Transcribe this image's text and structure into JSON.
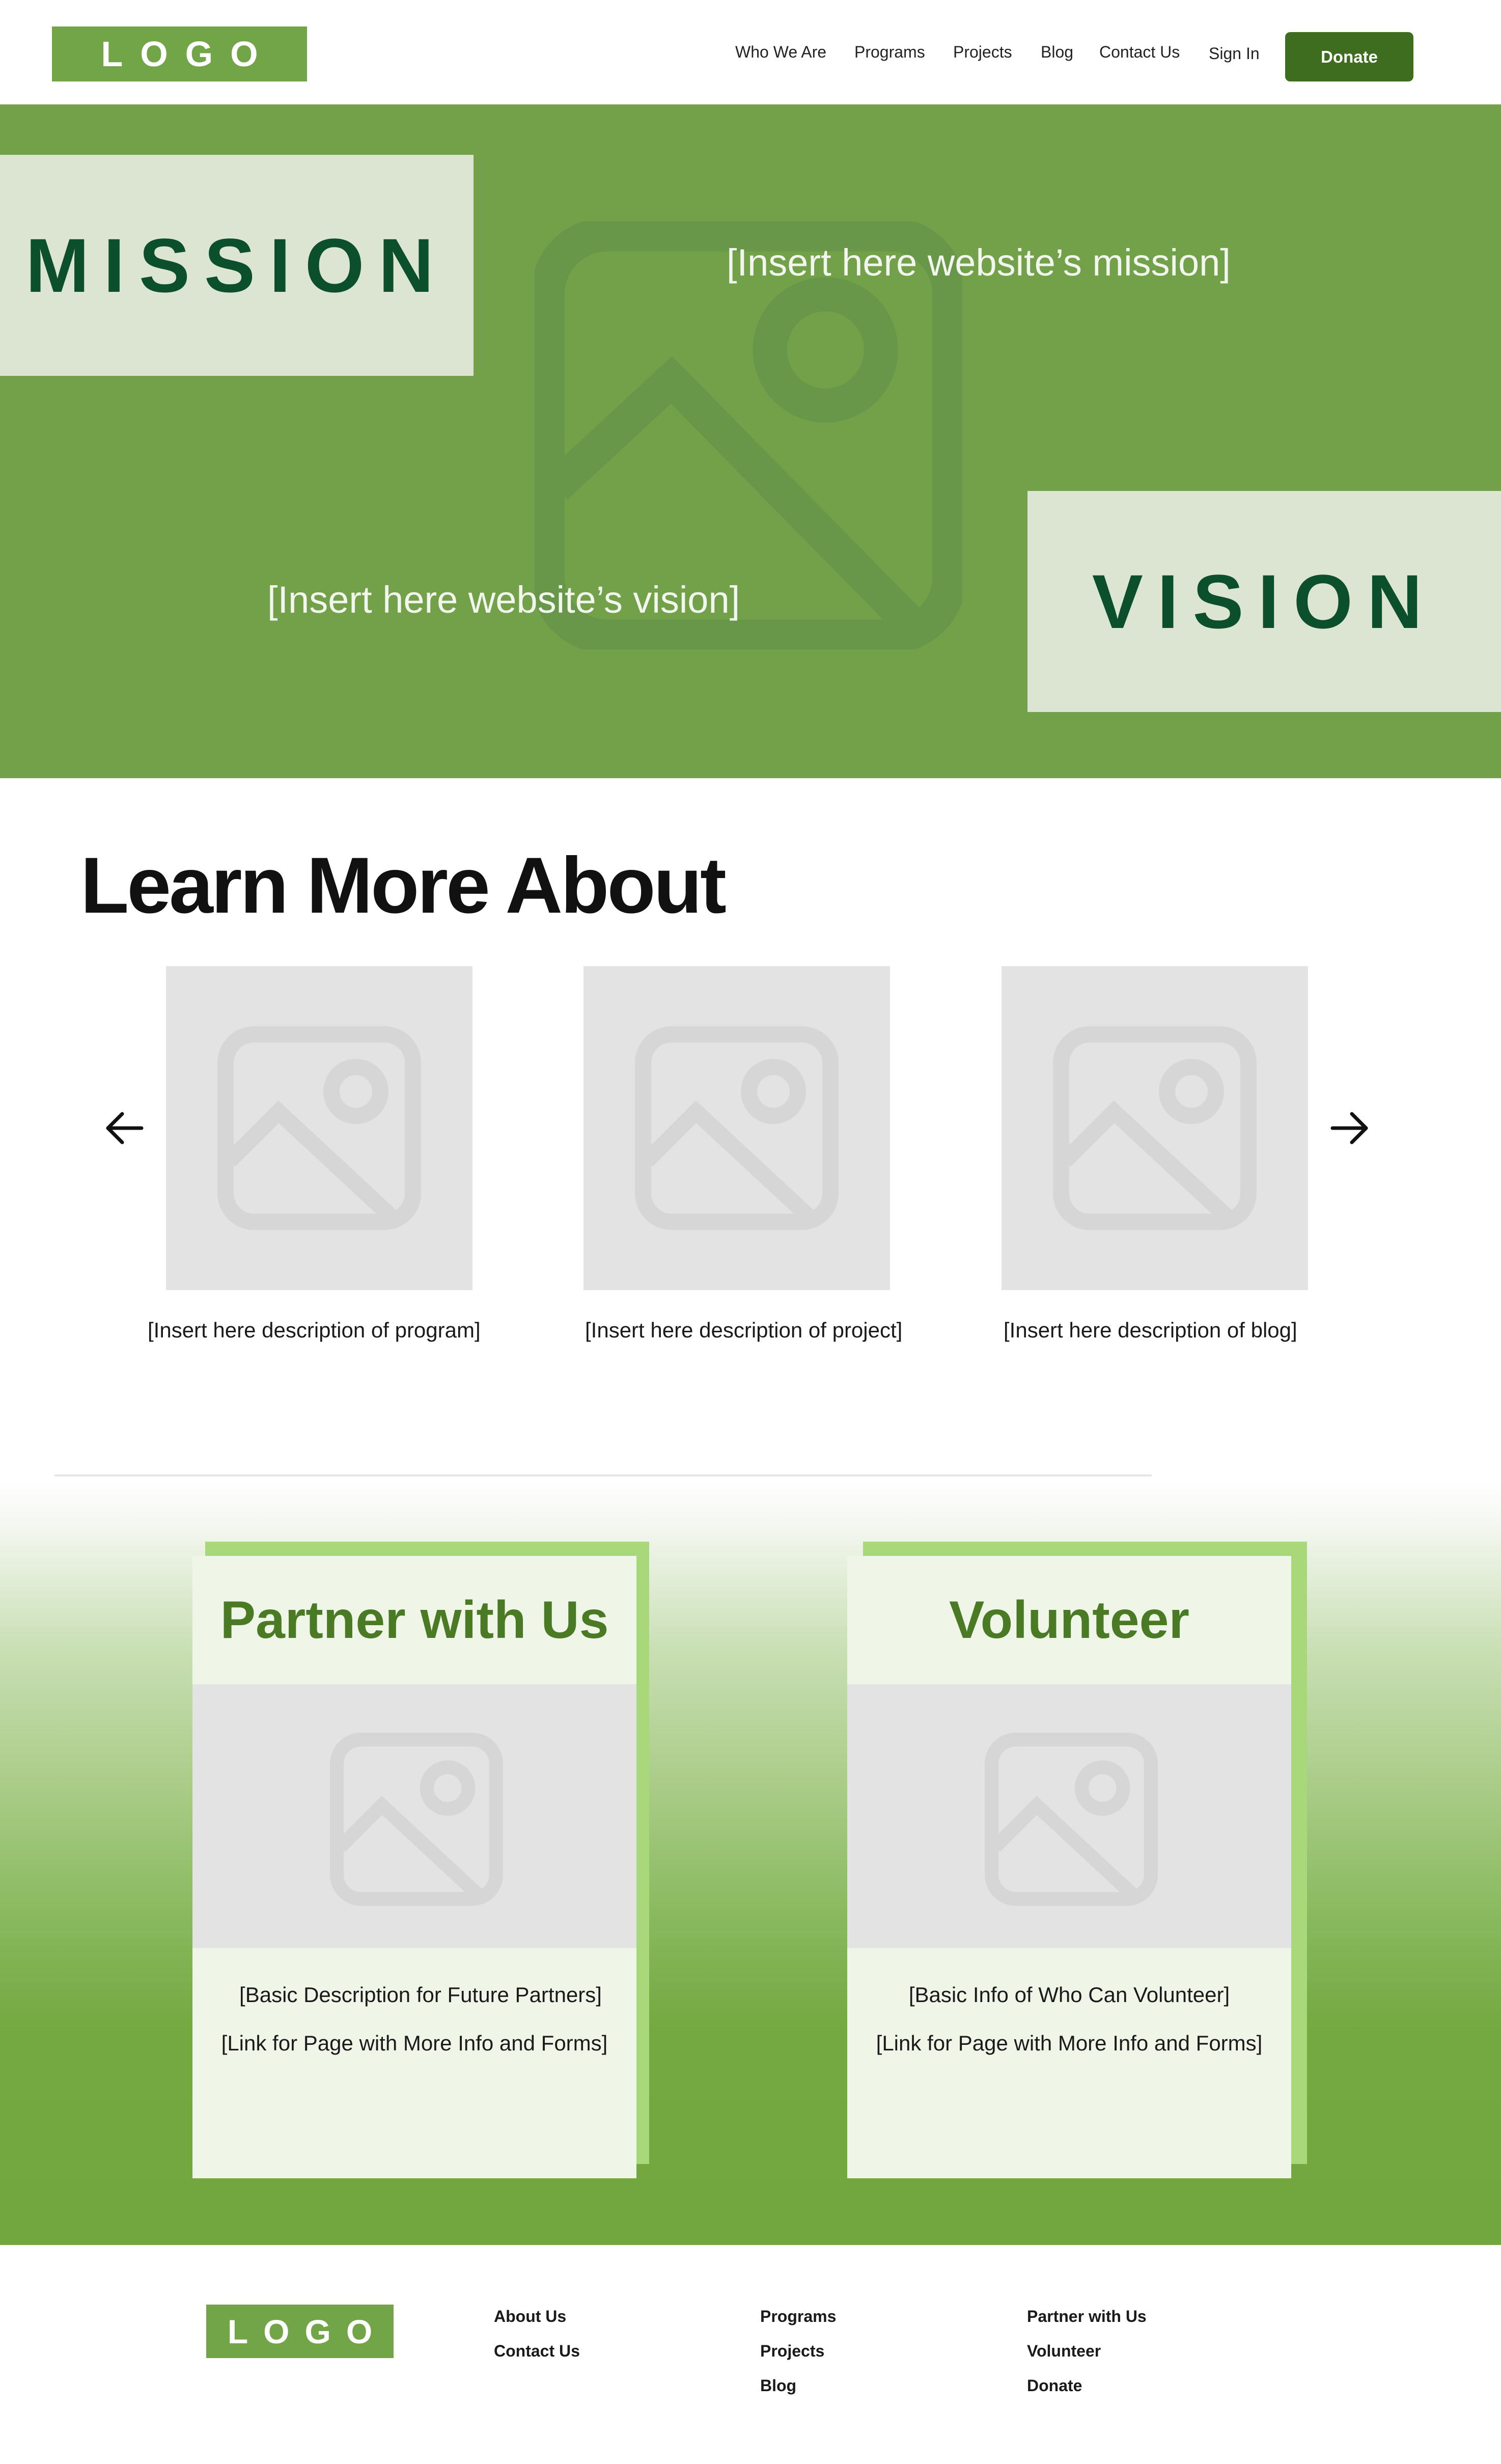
{
  "header": {
    "logo": "LOGO",
    "nav": [
      {
        "label": "Who We Are"
      },
      {
        "label": "Programs"
      },
      {
        "label": "Projects"
      },
      {
        "label": "Blog"
      },
      {
        "label": "Contact Us"
      },
      {
        "label": "Sign In"
      }
    ],
    "donate_label": "Donate"
  },
  "hero": {
    "background_icon": "image-placeholder-icon",
    "mission_label": "MISSION",
    "mission_text": "[Insert here website’s mission]",
    "vision_label": "VISION",
    "vision_text": "[Insert here website’s vision]"
  },
  "learn_more": {
    "title": "Learn More About",
    "prev_icon": "arrow-left-icon",
    "next_icon": "arrow-right-icon",
    "cards": [
      {
        "icon": "image-placeholder-icon",
        "description": "[Insert here description of program]"
      },
      {
        "icon": "image-placeholder-icon",
        "description": "[Insert here description of project]"
      },
      {
        "icon": "image-placeholder-icon",
        "description": "[Insert here description of blog]"
      }
    ]
  },
  "cta": {
    "partner": {
      "title": "Partner with Us",
      "line1": "[Basic Description for Future Partners]",
      "line2": "[Link for Page with More Info and Forms]"
    },
    "volunteer": {
      "title": "Volunteer",
      "line1": "[Basic Info of Who Can Volunteer]",
      "line2": "[Link for Page with More Info and Forms]"
    }
  },
  "footer": {
    "logo": "LOGO",
    "col1": [
      "About Us",
      "Contact Us"
    ],
    "col2": [
      "Programs",
      "Projects",
      "Blog"
    ],
    "col3": [
      "Partner with Us",
      "Volunteer",
      "Donate"
    ]
  },
  "colors": {
    "brand_green": "#72a548",
    "dark_green": "#0b4f2c",
    "donate_green": "#3f6d1e",
    "accent_light_green": "#a8d87a"
  }
}
